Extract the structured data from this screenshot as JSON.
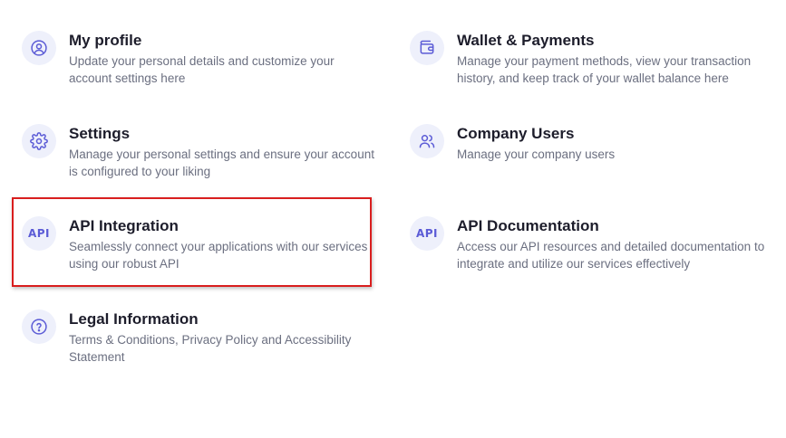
{
  "colors": {
    "icon_bg": "#eef0fb",
    "icon_fg": "#5b5bd6",
    "title": "#1d1d2b",
    "description": "#6b6f80",
    "highlight_border": "#d91e1e"
  },
  "items": [
    {
      "icon": "user-circle-icon",
      "title": "My profile",
      "description_line1": "Update your personal details and customize your",
      "description_line2": "account settings here"
    },
    {
      "icon": "wallet-icon",
      "title": "Wallet & Payments",
      "description_line1": "Manage your payment methods, view your transaction",
      "description_line2": "history, and keep track of your wallet balance here"
    },
    {
      "icon": "gear-icon",
      "title": "Settings",
      "description_line1": "Manage your personal settings and ensure your account",
      "description_line2": "is configured to your liking"
    },
    {
      "icon": "users-icon",
      "title": "Company Users",
      "description_line1": "Manage your company users",
      "description_line2": ""
    },
    {
      "icon": "api-icon",
      "icon_text": "API",
      "title": "API Integration",
      "description_line1": "Seamlessly connect your applications with our services",
      "description_line2": "using our robust API"
    },
    {
      "icon": "api-icon",
      "icon_text": "API",
      "title": "API Documentation",
      "description_line1": "Access our API resources and detailed documentation to",
      "description_line2": "integrate and utilize our services effectively"
    },
    {
      "icon": "question-circle-icon",
      "title": "Legal Information",
      "description_line1": "Terms & Conditions, Privacy Policy and Accessibility",
      "description_line2": "Statement"
    }
  ]
}
